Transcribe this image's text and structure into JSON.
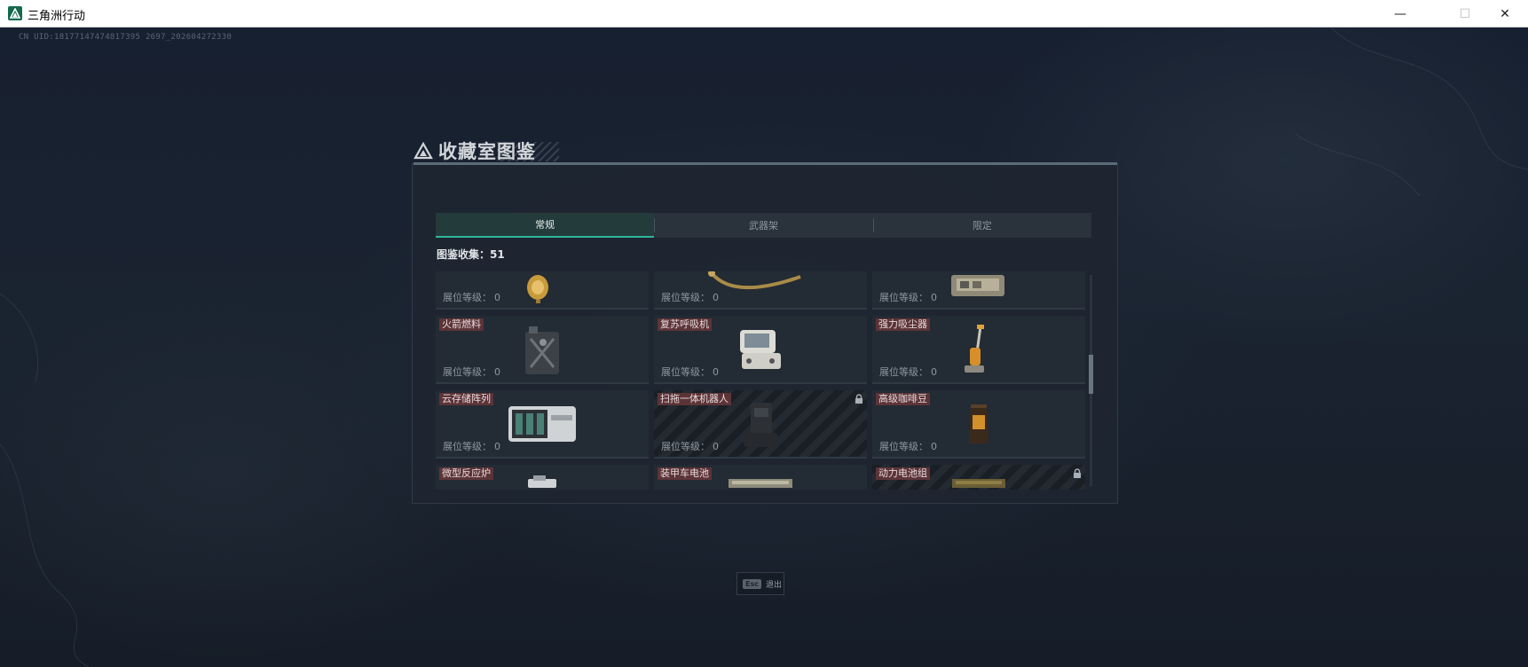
{
  "window": {
    "title": "三角洲行动",
    "minimize": "—",
    "maximize": "☐",
    "close": "✕"
  },
  "uid": "CN UID:18177147474817395 2697_202604272330",
  "dialog": {
    "title": "收藏室图鉴",
    "tabs": [
      {
        "label": "常规",
        "active": true
      },
      {
        "label": "武器架",
        "active": false
      },
      {
        "label": "限定",
        "active": false
      }
    ],
    "collect_label": "图鉴收集：",
    "collect_count": "51",
    "level_label": "展位等级：",
    "rows": [
      [
        {
          "name": "",
          "level": "0",
          "icon": "gold-watch-icon"
        },
        {
          "name": "",
          "level": "0",
          "icon": "golden-horn-icon"
        },
        {
          "name": "",
          "level": "0",
          "icon": "tool-case-icon"
        }
      ],
      [
        {
          "name": "火箭燃料",
          "level": "0",
          "icon": "fuel-can-icon"
        },
        {
          "name": "复苏呼吸机",
          "level": "0",
          "icon": "ventilator-icon"
        },
        {
          "name": "强力吸尘器",
          "level": "0",
          "icon": "vacuum-cleaner-icon"
        }
      ],
      [
        {
          "name": "云存储阵列",
          "level": "0",
          "icon": "storage-array-icon"
        },
        {
          "name": "扫拖一体机器人",
          "level": "0",
          "icon": "robot-mop-icon",
          "locked": true
        },
        {
          "name": "高级咖啡豆",
          "level": "0",
          "icon": "coffee-bag-icon"
        }
      ],
      [
        {
          "name": "微型反应炉",
          "level": "",
          "icon": "mini-reactor-icon"
        },
        {
          "name": "装甲车电池",
          "level": "",
          "icon": "vehicle-battery-icon"
        },
        {
          "name": "动力电池组",
          "level": "",
          "icon": "battery-pack-icon",
          "locked": true
        }
      ]
    ]
  },
  "esc": {
    "key": "Esc",
    "label": "退出"
  }
}
